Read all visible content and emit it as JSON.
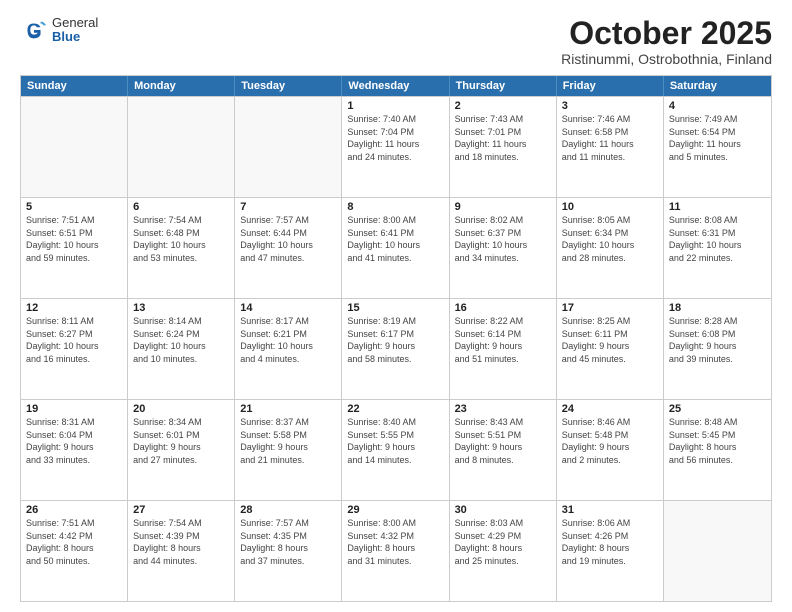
{
  "header": {
    "logo_general": "General",
    "logo_blue": "Blue",
    "month_title": "October 2025",
    "location": "Ristinummi, Ostrobothnia, Finland"
  },
  "calendar": {
    "days_of_week": [
      "Sunday",
      "Monday",
      "Tuesday",
      "Wednesday",
      "Thursday",
      "Friday",
      "Saturday"
    ],
    "weeks": [
      [
        {
          "day": "",
          "info": "",
          "empty": true
        },
        {
          "day": "",
          "info": "",
          "empty": true
        },
        {
          "day": "",
          "info": "",
          "empty": true
        },
        {
          "day": "1",
          "info": "Sunrise: 7:40 AM\nSunset: 7:04 PM\nDaylight: 11 hours\nand 24 minutes.",
          "empty": false
        },
        {
          "day": "2",
          "info": "Sunrise: 7:43 AM\nSunset: 7:01 PM\nDaylight: 11 hours\nand 18 minutes.",
          "empty": false
        },
        {
          "day": "3",
          "info": "Sunrise: 7:46 AM\nSunset: 6:58 PM\nDaylight: 11 hours\nand 11 minutes.",
          "empty": false
        },
        {
          "day": "4",
          "info": "Sunrise: 7:49 AM\nSunset: 6:54 PM\nDaylight: 11 hours\nand 5 minutes.",
          "empty": false
        }
      ],
      [
        {
          "day": "5",
          "info": "Sunrise: 7:51 AM\nSunset: 6:51 PM\nDaylight: 10 hours\nand 59 minutes.",
          "empty": false
        },
        {
          "day": "6",
          "info": "Sunrise: 7:54 AM\nSunset: 6:48 PM\nDaylight: 10 hours\nand 53 minutes.",
          "empty": false
        },
        {
          "day": "7",
          "info": "Sunrise: 7:57 AM\nSunset: 6:44 PM\nDaylight: 10 hours\nand 47 minutes.",
          "empty": false
        },
        {
          "day": "8",
          "info": "Sunrise: 8:00 AM\nSunset: 6:41 PM\nDaylight: 10 hours\nand 41 minutes.",
          "empty": false
        },
        {
          "day": "9",
          "info": "Sunrise: 8:02 AM\nSunset: 6:37 PM\nDaylight: 10 hours\nand 34 minutes.",
          "empty": false
        },
        {
          "day": "10",
          "info": "Sunrise: 8:05 AM\nSunset: 6:34 PM\nDaylight: 10 hours\nand 28 minutes.",
          "empty": false
        },
        {
          "day": "11",
          "info": "Sunrise: 8:08 AM\nSunset: 6:31 PM\nDaylight: 10 hours\nand 22 minutes.",
          "empty": false
        }
      ],
      [
        {
          "day": "12",
          "info": "Sunrise: 8:11 AM\nSunset: 6:27 PM\nDaylight: 10 hours\nand 16 minutes.",
          "empty": false
        },
        {
          "day": "13",
          "info": "Sunrise: 8:14 AM\nSunset: 6:24 PM\nDaylight: 10 hours\nand 10 minutes.",
          "empty": false
        },
        {
          "day": "14",
          "info": "Sunrise: 8:17 AM\nSunset: 6:21 PM\nDaylight: 10 hours\nand 4 minutes.",
          "empty": false
        },
        {
          "day": "15",
          "info": "Sunrise: 8:19 AM\nSunset: 6:17 PM\nDaylight: 9 hours\nand 58 minutes.",
          "empty": false
        },
        {
          "day": "16",
          "info": "Sunrise: 8:22 AM\nSunset: 6:14 PM\nDaylight: 9 hours\nand 51 minutes.",
          "empty": false
        },
        {
          "day": "17",
          "info": "Sunrise: 8:25 AM\nSunset: 6:11 PM\nDaylight: 9 hours\nand 45 minutes.",
          "empty": false
        },
        {
          "day": "18",
          "info": "Sunrise: 8:28 AM\nSunset: 6:08 PM\nDaylight: 9 hours\nand 39 minutes.",
          "empty": false
        }
      ],
      [
        {
          "day": "19",
          "info": "Sunrise: 8:31 AM\nSunset: 6:04 PM\nDaylight: 9 hours\nand 33 minutes.",
          "empty": false
        },
        {
          "day": "20",
          "info": "Sunrise: 8:34 AM\nSunset: 6:01 PM\nDaylight: 9 hours\nand 27 minutes.",
          "empty": false
        },
        {
          "day": "21",
          "info": "Sunrise: 8:37 AM\nSunset: 5:58 PM\nDaylight: 9 hours\nand 21 minutes.",
          "empty": false
        },
        {
          "day": "22",
          "info": "Sunrise: 8:40 AM\nSunset: 5:55 PM\nDaylight: 9 hours\nand 14 minutes.",
          "empty": false
        },
        {
          "day": "23",
          "info": "Sunrise: 8:43 AM\nSunset: 5:51 PM\nDaylight: 9 hours\nand 8 minutes.",
          "empty": false
        },
        {
          "day": "24",
          "info": "Sunrise: 8:46 AM\nSunset: 5:48 PM\nDaylight: 9 hours\nand 2 minutes.",
          "empty": false
        },
        {
          "day": "25",
          "info": "Sunrise: 8:48 AM\nSunset: 5:45 PM\nDaylight: 8 hours\nand 56 minutes.",
          "empty": false
        }
      ],
      [
        {
          "day": "26",
          "info": "Sunrise: 7:51 AM\nSunset: 4:42 PM\nDaylight: 8 hours\nand 50 minutes.",
          "empty": false
        },
        {
          "day": "27",
          "info": "Sunrise: 7:54 AM\nSunset: 4:39 PM\nDaylight: 8 hours\nand 44 minutes.",
          "empty": false
        },
        {
          "day": "28",
          "info": "Sunrise: 7:57 AM\nSunset: 4:35 PM\nDaylight: 8 hours\nand 37 minutes.",
          "empty": false
        },
        {
          "day": "29",
          "info": "Sunrise: 8:00 AM\nSunset: 4:32 PM\nDaylight: 8 hours\nand 31 minutes.",
          "empty": false
        },
        {
          "day": "30",
          "info": "Sunrise: 8:03 AM\nSunset: 4:29 PM\nDaylight: 8 hours\nand 25 minutes.",
          "empty": false
        },
        {
          "day": "31",
          "info": "Sunrise: 8:06 AM\nSunset: 4:26 PM\nDaylight: 8 hours\nand 19 minutes.",
          "empty": false
        },
        {
          "day": "",
          "info": "",
          "empty": true
        }
      ]
    ]
  }
}
